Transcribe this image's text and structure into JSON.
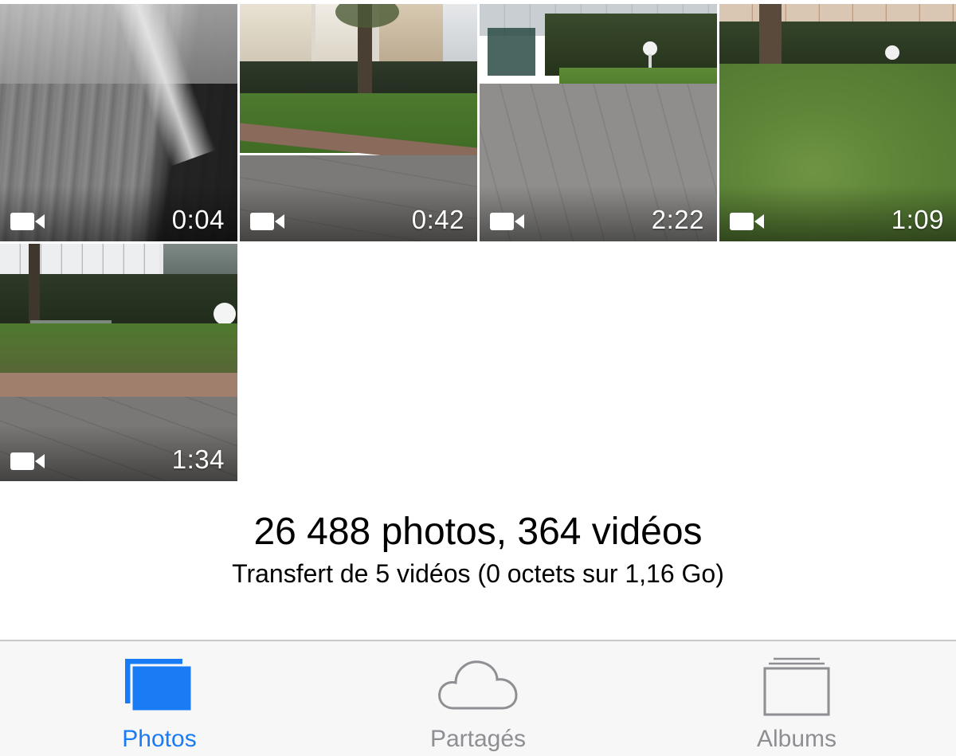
{
  "videos": [
    {
      "duration": "0:04"
    },
    {
      "duration": "0:42"
    },
    {
      "duration": "2:22"
    },
    {
      "duration": "1:09"
    },
    {
      "duration": "1:34"
    }
  ],
  "library": {
    "count": "26 488 photos, 364 vidéos",
    "transfer": "Transfert de 5 vidéos (0 octets sur 1,16 Go)"
  },
  "tabs": [
    {
      "label": "Photos",
      "icon": "photos-icon",
      "active": true
    },
    {
      "label": "Partagés",
      "icon": "cloud-icon",
      "active": false
    },
    {
      "label": "Albums",
      "icon": "albums-icon",
      "active": false
    }
  ],
  "colors": {
    "accent": "#1a7cf5",
    "inactive": "#8e8e93",
    "tabbar_bg": "#f7f7f7"
  }
}
